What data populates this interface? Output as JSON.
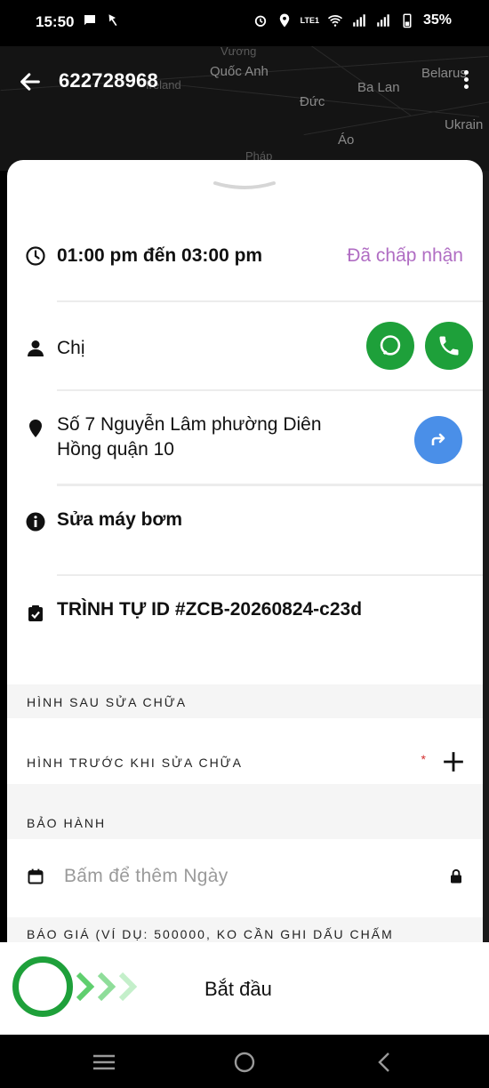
{
  "status_bar": {
    "time": "15:50",
    "battery": "35%",
    "network_label": "LTE1"
  },
  "map": {
    "labels": [
      "Vương",
      "Quốc Anh",
      "Ireland",
      "Ba Lan",
      "Belarus",
      "Đức",
      "Ukrain",
      "Áo",
      "Pháp"
    ]
  },
  "header": {
    "title": "622728968"
  },
  "schedule": {
    "time_range": "01:00 pm đến 03:00 pm",
    "status": "Đã chấp nhận"
  },
  "customer": {
    "name": "Chị"
  },
  "address": {
    "line1": "Số 7 Nguyễn Lâm phường Diên",
    "line2": "Hồng quận 10"
  },
  "service": {
    "name": "Sửa máy bơm"
  },
  "order": {
    "id_label": "TRÌNH TỰ ID #ZCB-20260824-c23d"
  },
  "sections": {
    "after_repair": "HÌNH SAU SỬA CHỮA",
    "before_repair": "HÌNH TRƯỚC KHI SỬA CHỮA",
    "required_mark": "*",
    "warranty": "BẢO HÀNH",
    "date_placeholder": "Bấm để thêm Ngày",
    "quote": "BÁO GIÁ (VÍ DỤ: 500000, KO CẦN GHI DẤU CHẤM"
  },
  "action": {
    "start_label": "Bắt đầu"
  },
  "colors": {
    "accent_green": "#1ea03a",
    "accent_blue": "#4a8fe8",
    "status_purple": "#b06dc3"
  }
}
